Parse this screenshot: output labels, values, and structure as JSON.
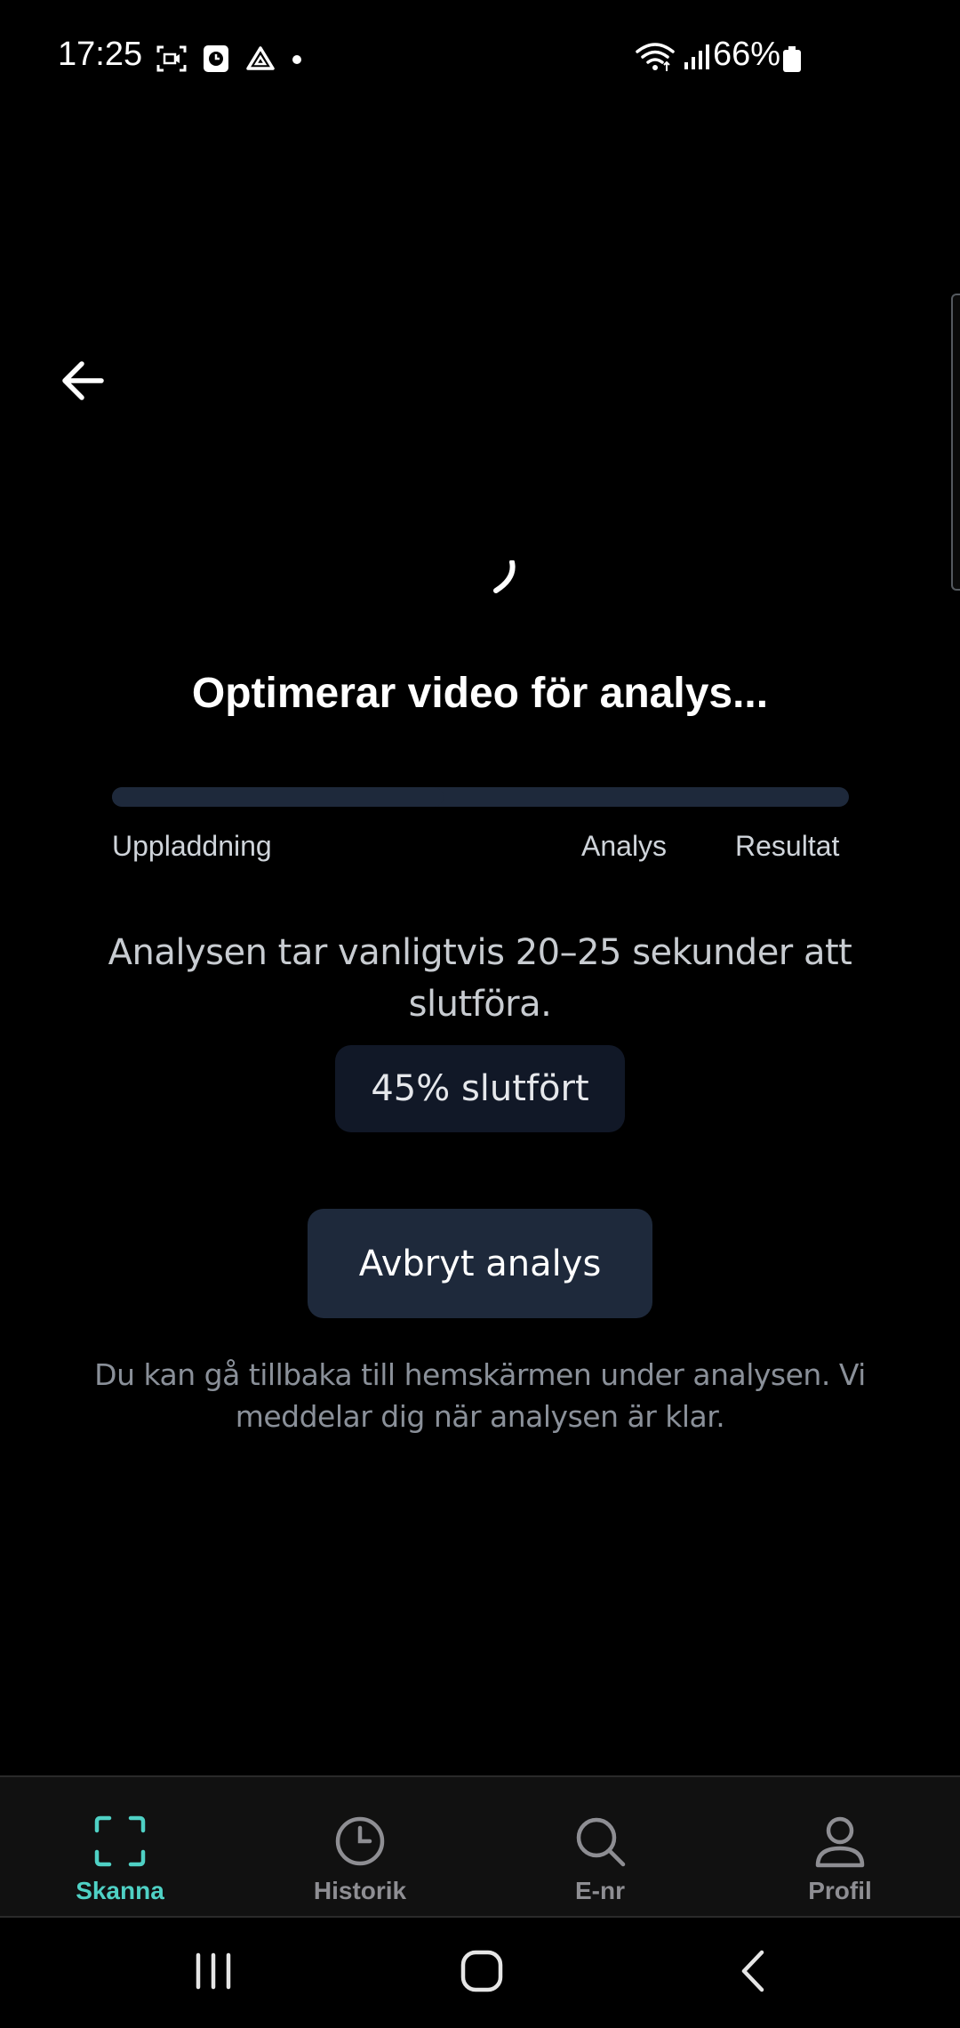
{
  "status_bar": {
    "time": "17:25",
    "battery_percent": "66%",
    "icons": [
      "screen-record-icon",
      "clock-app-icon",
      "drive-icon",
      "notification-dot-icon",
      "wifi-icon",
      "signal-icon",
      "battery-icon"
    ]
  },
  "header": {
    "back_icon": "arrow-left-icon"
  },
  "main": {
    "title": "Optimerar video för analys...",
    "progress": {
      "fraction": 0.45,
      "steps": [
        "Uppladdning",
        "Analys",
        "Resultat"
      ]
    },
    "info_text": "Analysen tar vanligtvis 20–25 sekunder att slutföra.",
    "percent_label": "45% slutfört",
    "cancel_label": "Avbryt analys",
    "footnote": "Du kan gå tillbaka till hemskärmen under analysen. Vi meddelar dig när analysen är klar."
  },
  "tab_bar": {
    "items": [
      {
        "label": "Skanna",
        "icon": "scan-frame-icon",
        "active": true
      },
      {
        "label": "Historik",
        "icon": "clock-icon",
        "active": false
      },
      {
        "label": "E-nr",
        "icon": "search-icon",
        "active": false
      },
      {
        "label": "Profil",
        "icon": "user-icon",
        "active": false
      }
    ]
  },
  "colors": {
    "background": "#000000",
    "accent": "#4fd1c5",
    "surface": "#1e293b",
    "badge": "#111827",
    "tab_bar": "#111111",
    "inactive_tab": "#8e8e93"
  }
}
